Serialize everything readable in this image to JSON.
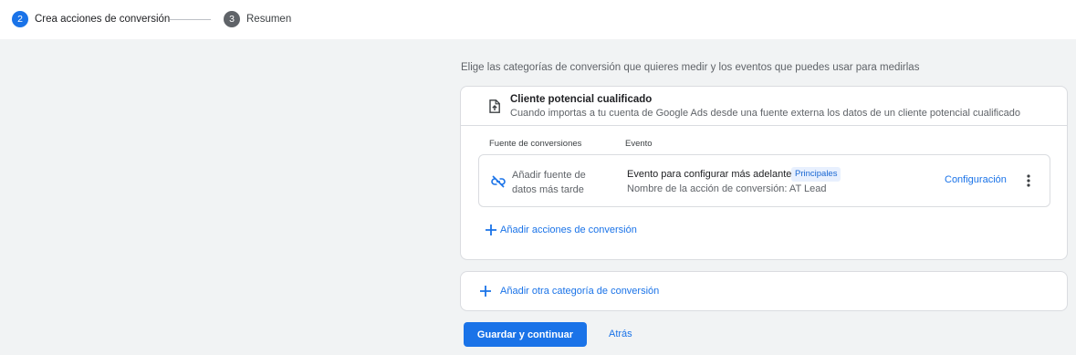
{
  "stepper": {
    "steps": [
      {
        "number": "2",
        "label": "Crea acciones de conversión",
        "state": "active"
      },
      {
        "number": "3",
        "label": "Resumen",
        "state": "pending"
      }
    ],
    "colors": {
      "active": "#1a73e8",
      "pending": "#5f6368"
    }
  },
  "intro": "Elige las categorías de conversión que quieres medir y los eventos que puedes usar para medirlas",
  "category": {
    "icon": "document-upload-icon",
    "title": "Cliente potencial cualificado",
    "description": "Cuando importas a tu cuenta de Google Ads desde una fuente externa los datos de un cliente potencial cualificado",
    "columns": {
      "source": "Fuente de conversiones",
      "event": "Evento"
    },
    "row": {
      "source_icon": "link-off-icon",
      "source_label": "Añadir fuente de datos más tarde",
      "event_name": "Evento para configurar más adelante",
      "badge": "Principales",
      "action_name": "Nombre de la acción de conversión: AT Lead",
      "config_label": "Configuración",
      "menu_icon": "more-vert-icon"
    },
    "add_actions_label": "Añadir acciones de conversión"
  },
  "add_category_label": "Añadir otra categoría de conversión",
  "footer": {
    "primary_label": "Guardar y continuar",
    "back_label": "Atrás"
  },
  "colors": {
    "accent": "#1a73e8",
    "badge_bg": "#e8f0fe"
  }
}
